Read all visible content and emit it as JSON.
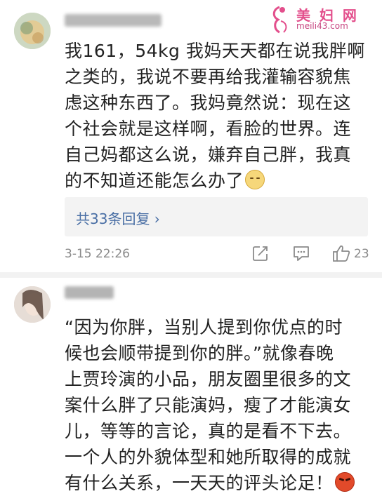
{
  "watermark": {
    "title": "美 妇 网",
    "url": "meili43.com"
  },
  "comments": [
    {
      "lines": [
        "我161，54kg 我妈天天都在说我胖啊",
        "之类的，我说不要再给我灌输容貌焦",
        "虑这种东西了。我妈竟然说：现在这",
        "个社会就是这样啊，看脸的世界。连",
        "自己妈都这么说，嫌弃自己胖，我真",
        "的不知道还能怎么办了"
      ],
      "trailing_emoji": "blush-emoji",
      "reply_link": "共33条回复 ›",
      "timestamp": "3-15 22:26",
      "like_count": "23"
    },
    {
      "lines": [
        "“因为你胖，当别人提到你优点的时",
        "候也会顺带提到你的胖。”就像春晚",
        "上贾玲演的小品，朋友圈里很多的文",
        "案什么胖了只能演妈，瘦了才能演女",
        "儿，等等的言论，真的是看不下去。",
        "一个人的外貌体型和她所取得的成就",
        "有什么关系，一天天的评头论足！"
      ],
      "trailing_emoji": "angry-emoji"
    }
  ],
  "colors": {
    "text": "#222222",
    "link": "#4a6fa5",
    "meta": "#8a8a8a",
    "reply_bg": "#f3f3f3",
    "watermark": "#e34f8c"
  },
  "icons": [
    "share-icon",
    "comment-icon",
    "like-icon"
  ]
}
